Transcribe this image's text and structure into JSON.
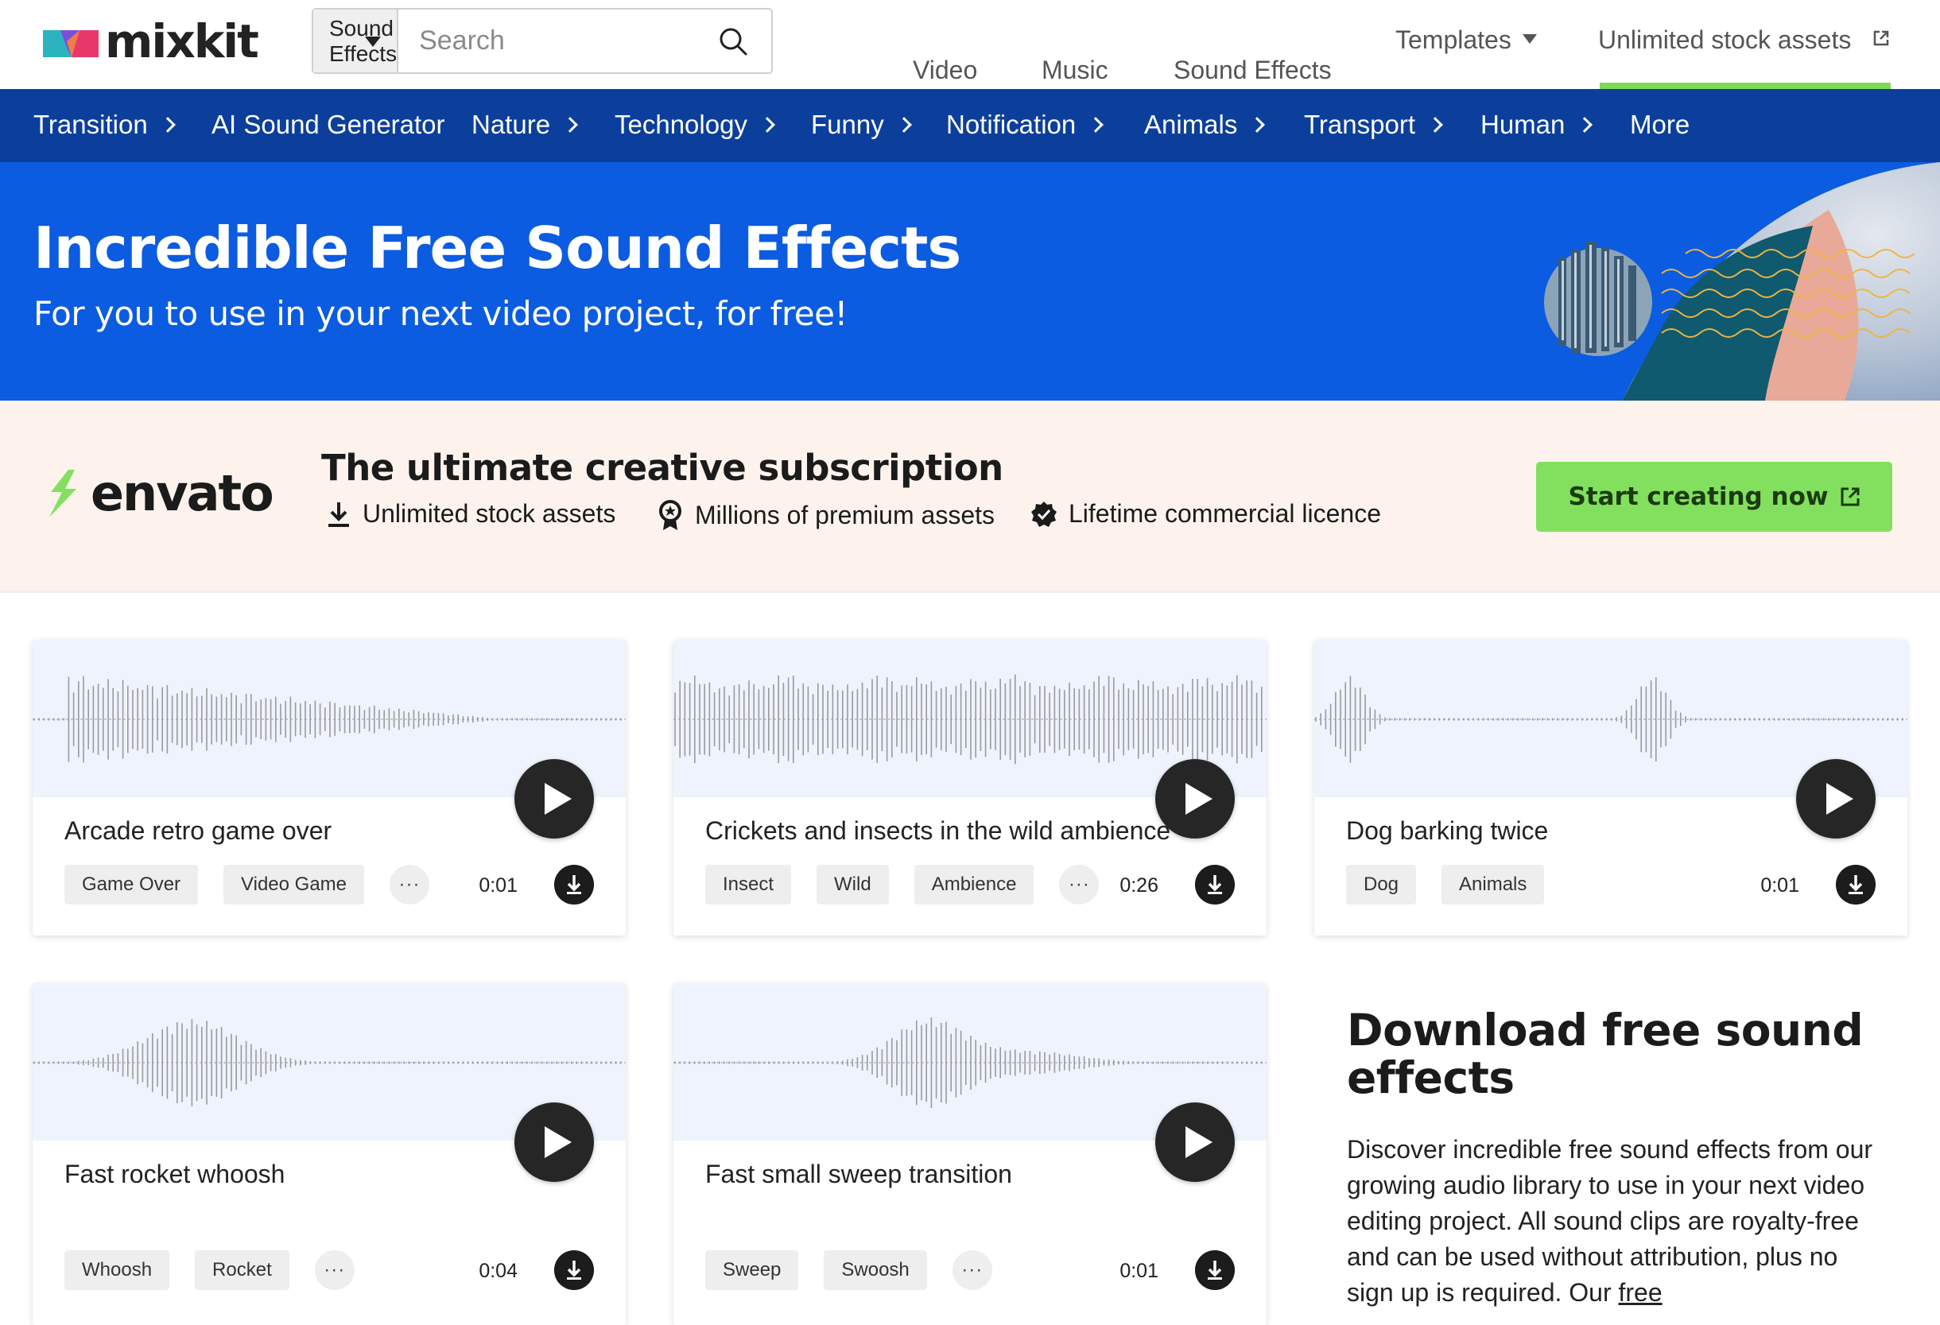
{
  "header": {
    "logo_text": "mixkit",
    "search_category": "Sound Effects",
    "search_placeholder": "Search",
    "nav": [
      {
        "label": "Video"
      },
      {
        "label": "Music"
      },
      {
        "label": "Sound Effects"
      },
      {
        "label": "Templates"
      },
      {
        "label": "Unlimited stock assets"
      }
    ],
    "accent_color": "#7ed957"
  },
  "categories": [
    {
      "label": "Transition"
    },
    {
      "label": "AI Sound Generator"
    },
    {
      "label": "Nature"
    },
    {
      "label": "Technology"
    },
    {
      "label": "Funny"
    },
    {
      "label": "Notification"
    },
    {
      "label": "Animals"
    },
    {
      "label": "Transport"
    },
    {
      "label": "Human"
    },
    {
      "label": "More"
    }
  ],
  "hero": {
    "title": "Incredible Free Sound Effects",
    "subtitle": "For you to use in your next video project, for free!",
    "background_color": "#0b5ce0"
  },
  "envato": {
    "logo_text": "envato",
    "title": "The ultimate creative subscription",
    "features": [
      "Unlimited stock assets",
      "Millions of premium assets",
      "Lifetime commercial licence"
    ],
    "cta_label": "Start creating now",
    "cta_color": "#82e05e"
  },
  "cards": [
    {
      "title": "Arcade retro game over",
      "tags": [
        "Game Over",
        "Video Game"
      ],
      "duration": "0:01"
    },
    {
      "title": "Crickets and insects in the wild ambience",
      "tags": [
        "Insect",
        "Wild",
        "Ambience"
      ],
      "duration": "0:26"
    },
    {
      "title": "Dog barking twice",
      "tags": [
        "Dog",
        "Animals"
      ],
      "duration": "0:01"
    },
    {
      "title": "Fast rocket whoosh",
      "tags": [
        "Whoosh",
        "Rocket"
      ],
      "duration": "0:04"
    },
    {
      "title": "Fast small sweep transition",
      "tags": [
        "Sweep",
        "Swoosh"
      ],
      "duration": "0:01"
    }
  ],
  "side": {
    "title": "Download free sound effects",
    "body": "Discover incredible free sound effects from our growing audio library to use in your next video editing project. All sound clips are royalty-free and can be used without attribution, plus no sign up is required. Our ",
    "link_text": "free"
  }
}
